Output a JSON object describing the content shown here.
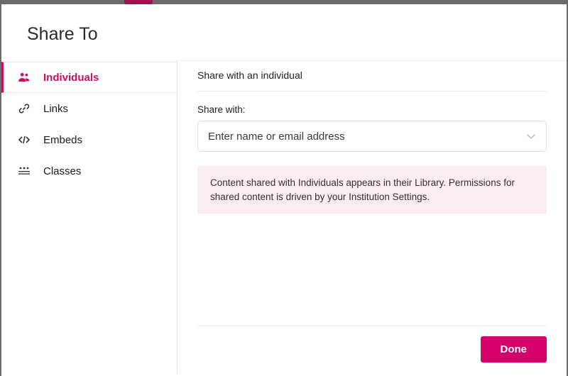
{
  "modal": {
    "title": "Share To"
  },
  "sidebar": {
    "items": [
      {
        "label": "Individuals"
      },
      {
        "label": "Links"
      },
      {
        "label": "Embeds"
      },
      {
        "label": "Classes"
      }
    ]
  },
  "main": {
    "heading": "Share with an individual",
    "field_label": "Share with:",
    "select_placeholder": "Enter name or email address",
    "info": "Content shared with Individuals appears in their Library. Permissions for shared content is driven by your Institution Settings."
  },
  "footer": {
    "done_label": "Done"
  },
  "colors": {
    "accent": "#d6006d",
    "info_bg": "#fbecef"
  }
}
